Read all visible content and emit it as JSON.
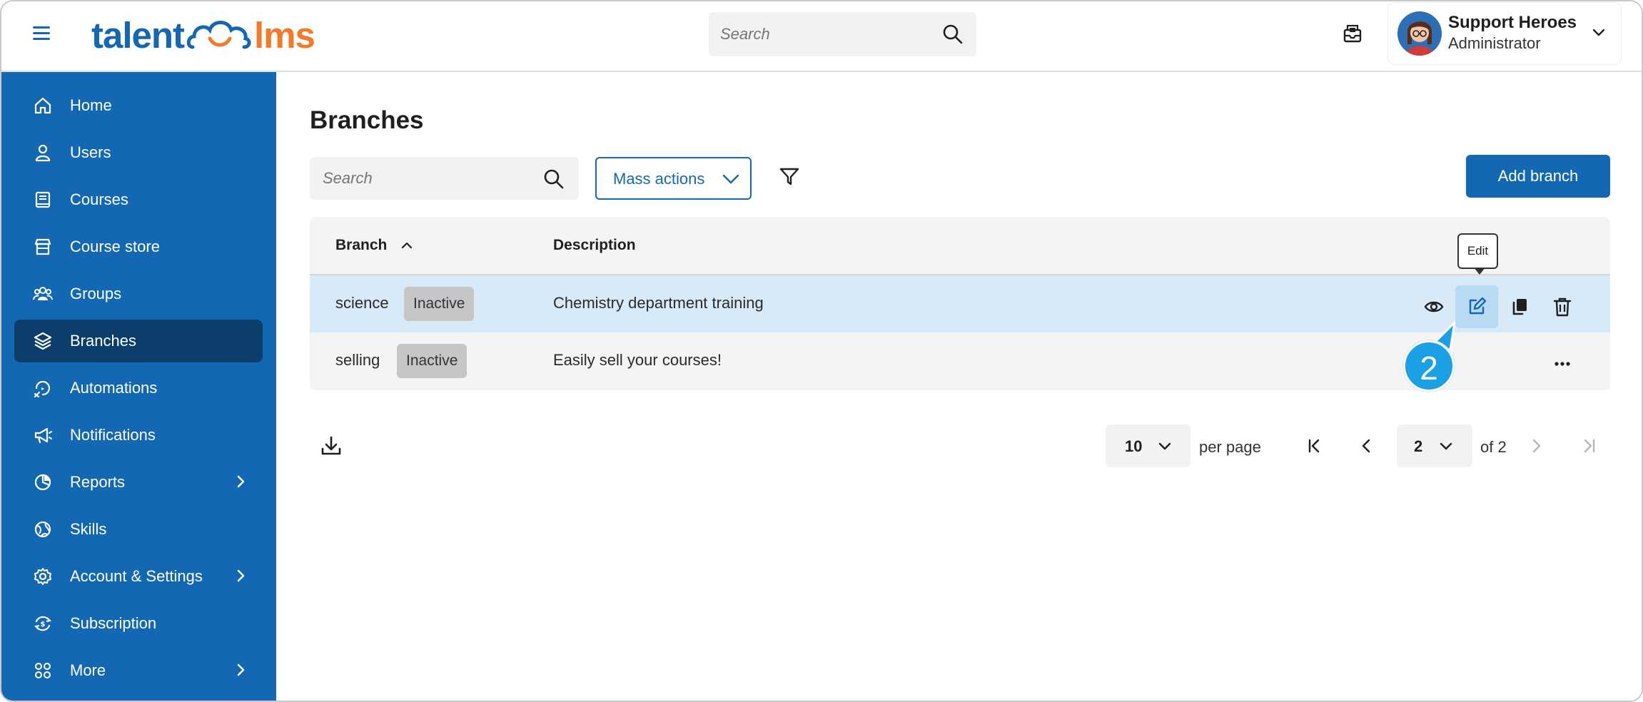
{
  "brand": {
    "part1": "talent",
    "part2": "lms",
    "primary_color": "#1468b3",
    "accent_color": "#f27a2a"
  },
  "header": {
    "search": {
      "placeholder": "Search"
    },
    "user": {
      "name": "Support Heroes",
      "role": "Administrator"
    },
    "icons": [
      "hamburger-icon",
      "search-icon",
      "messages-icon",
      "chevron-down-icon"
    ]
  },
  "sidebar": {
    "background": "#1468b3",
    "active_background": "#0c3d6b",
    "items": [
      {
        "label": "Home",
        "icon": "home-icon",
        "has_submenu": false,
        "active": false
      },
      {
        "label": "Users",
        "icon": "user-icon",
        "has_submenu": false,
        "active": false
      },
      {
        "label": "Courses",
        "icon": "book-icon",
        "has_submenu": false,
        "active": false
      },
      {
        "label": "Course store",
        "icon": "store-icon",
        "has_submenu": false,
        "active": false
      },
      {
        "label": "Groups",
        "icon": "groups-icon",
        "has_submenu": false,
        "active": false
      },
      {
        "label": "Branches",
        "icon": "layers-icon",
        "has_submenu": false,
        "active": true
      },
      {
        "label": "Automations",
        "icon": "automation-icon",
        "has_submenu": false,
        "active": false
      },
      {
        "label": "Notifications",
        "icon": "megaphone-icon",
        "has_submenu": false,
        "active": false
      },
      {
        "label": "Reports",
        "icon": "pie-chart-icon",
        "has_submenu": true,
        "active": false
      },
      {
        "label": "Skills",
        "icon": "globe-icon",
        "has_submenu": false,
        "active": false
      },
      {
        "label": "Account & Settings",
        "icon": "gear-icon",
        "has_submenu": true,
        "active": false
      },
      {
        "label": "Subscription",
        "icon": "subscription-icon",
        "has_submenu": false,
        "active": false
      },
      {
        "label": "More",
        "icon": "grid-icon",
        "has_submenu": true,
        "active": false
      }
    ]
  },
  "main": {
    "title": "Branches",
    "search": {
      "placeholder": "Search"
    },
    "mass_actions_label": "Mass actions",
    "add_button_label": "Add branch",
    "table": {
      "columns": [
        "Branch",
        "Description"
      ],
      "sort": {
        "column": "Branch",
        "direction": "ascending"
      },
      "rows": [
        {
          "branch": "science",
          "status": "Inactive",
          "description": "Chemistry department training",
          "highlighted": true,
          "actions": [
            "view-icon",
            "edit-icon",
            "copy-icon",
            "delete-icon"
          ]
        },
        {
          "branch": "selling",
          "status": "Inactive",
          "description": "Easily sell your courses!",
          "highlighted": false,
          "actions": [
            "more-icon"
          ]
        }
      ]
    },
    "tooltip": "Edit",
    "step_marker": "2",
    "pagination": {
      "per_page_value": "10",
      "per_page_label": "per page",
      "current_page": "2",
      "of_label": "of 2"
    }
  }
}
